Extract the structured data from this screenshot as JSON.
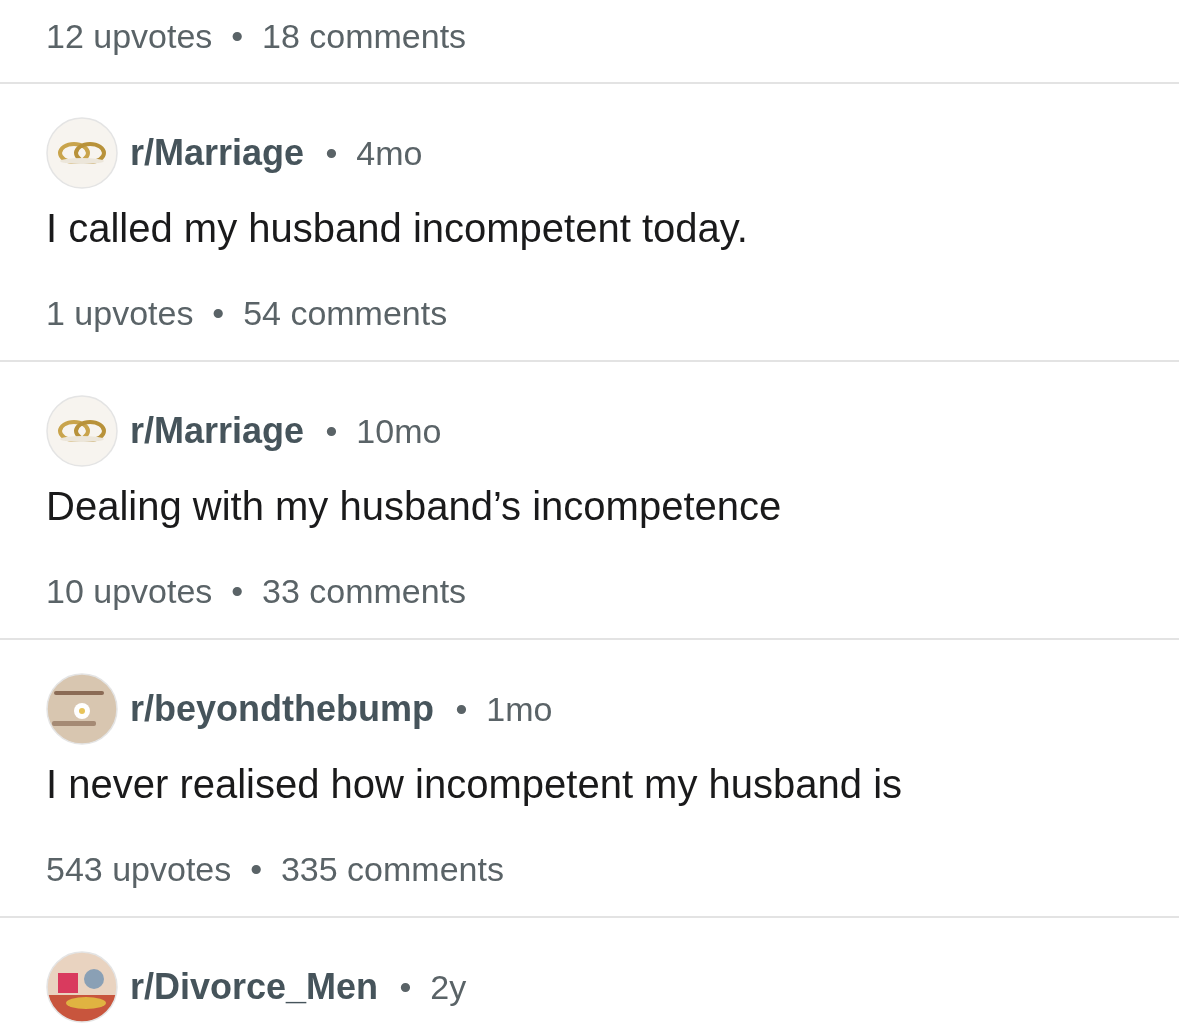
{
  "previous_post": {
    "meta": "12 upvotes • 18 comments"
  },
  "posts": [
    {
      "subreddit": "r/Marriage",
      "age": "• 4mo",
      "title": "I called my husband incompetent today.",
      "meta": "1 upvotes • 54 comments"
    },
    {
      "subreddit": "r/Marriage",
      "age": "• 10mo",
      "title": "Dealing with my husband’s incompetence",
      "meta": "10 upvotes • 33 comments"
    },
    {
      "subreddit": "r/beyondthebump",
      "age": "• 1mo",
      "title": "I never realised how incompetent my husband is",
      "meta": "543 upvotes • 335 comments"
    },
    {
      "subreddit": "r/Divorce_Men",
      "age": "• 2y"
    }
  ]
}
